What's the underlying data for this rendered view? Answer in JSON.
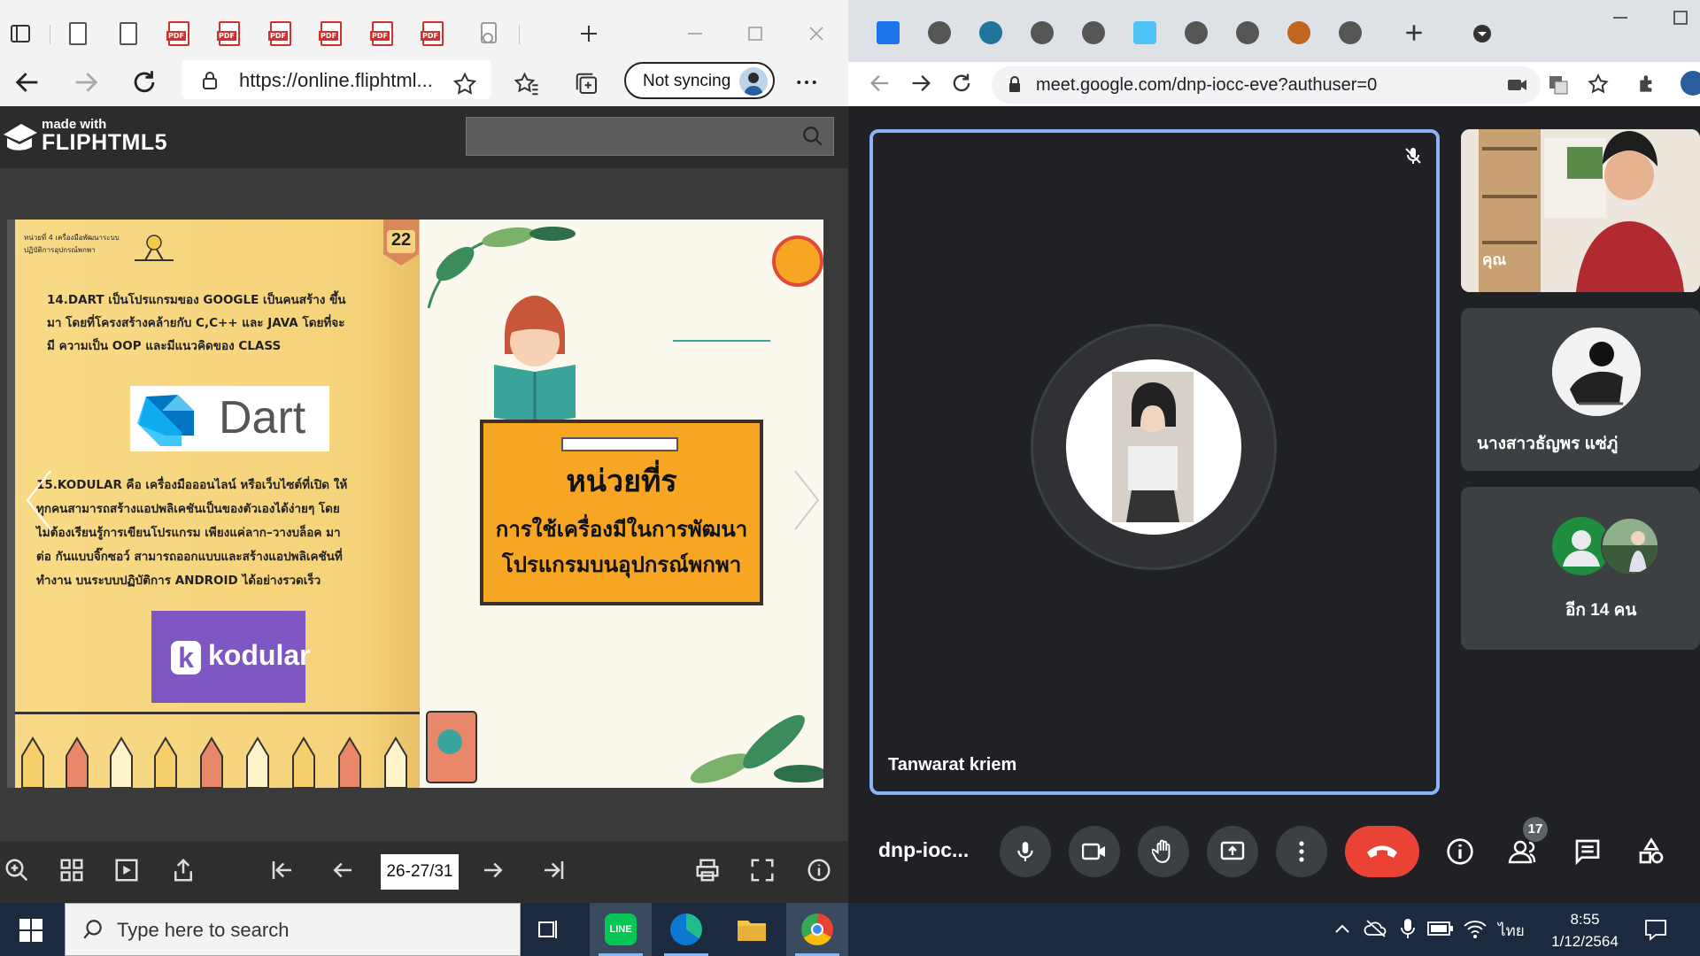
{
  "edge": {
    "url": "https://online.fliphtml...",
    "sync_label": "Not syncing",
    "brand_small": "made with",
    "brand_big": "FLIPHTML5",
    "pdf_label": "PDF",
    "page_indicator": "26-27/31",
    "left_page": {
      "page_number": "22",
      "header_line1": "หน่วยที่ 4 เครื่องมือพัฒนาระบบ",
      "header_line2": "ปฏิบัติการอุปกรณ์พกพา",
      "dart_para": "14.DART เป็นโปรแกรมของ GOOGLE  เป็นคนสร้าง ขึ้นมา โดยที่โครงสร้างคล้ายกับ C,C++ และ JAVA โดยที่จะมี ความเป็น OOP และมีแนวคิดของ CLASS",
      "dart_logo": "Dart",
      "kodular_para": "15.KODULAR คือ เครื่องมือออนไลน์ หรือเว็บไซต์ที่เปิด ให้ทุกคนสามารถสร้างแอปพลิเคชันเป็นของตัวเองได้ง่ายๆ โดย ไม่ต้องเรียนรู้การเขียนโปรแกรม เพียงแค่ลาก–วางบล็อค มาต่อ กันแบบจิ๊กซอว์ สามารถออกแบบและสร้างแอปพลิเคชันที่ทำงาน บนระบบปฏิบัติการ ANDROID ได้อย่างรวดเร็ว",
      "kodular_logo": "kodular"
    },
    "right_page": {
      "title": "หน่วยที่ร",
      "subtitle_line1": "การใช้เครื่องมีในการพัฒนา",
      "subtitle_line2": "โปรแกรมบนอุปกรณ์พกพา"
    }
  },
  "chrome": {
    "url": "meet.google.com/dnp-iocc-eve?authuser=0",
    "main_participant": "Tanwarat kriem",
    "self_label": "คุณ",
    "participant_2": "นางสาวธัญพร แซ่ภู่",
    "others_label": "อีก 14 คน",
    "meeting_code": "dnp-ioc...",
    "people_count": "17"
  },
  "taskbar": {
    "search_placeholder": "Type here to search",
    "language": "ไทย",
    "time": "8:55",
    "date": "1/12/2564"
  },
  "colors": {
    "meet_blue": "#8ab4f8",
    "hangup_red": "#ea4335",
    "page_yellow": "#f6d37a",
    "banner_orange": "#f6a623",
    "kodular_purple": "#7e57c2",
    "dart_blue": "#0175c2"
  }
}
